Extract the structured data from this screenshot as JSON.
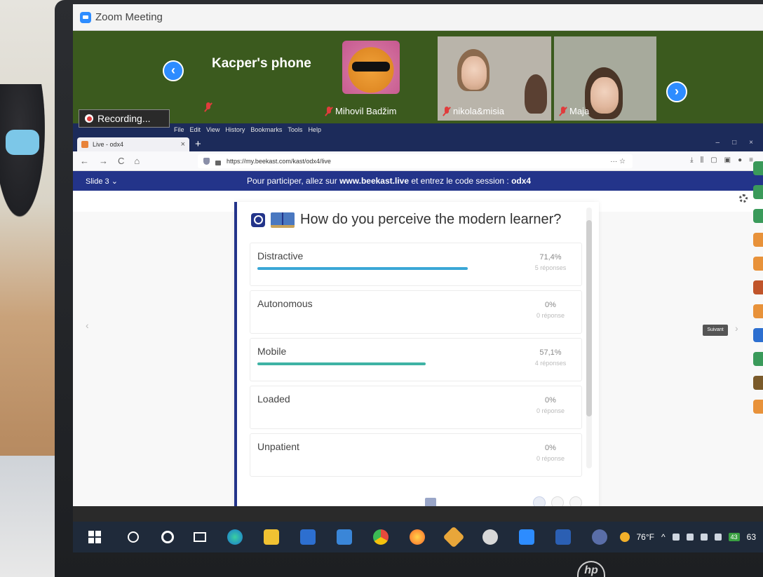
{
  "zoom": {
    "window_title": "Zoom Meeting",
    "participants": [
      {
        "name": "Kacper's phone"
      },
      {
        "name": "Mihovil Badžim"
      },
      {
        "name": "nikola&misia"
      },
      {
        "name": "Maja"
      }
    ],
    "recording_label": "Recording...",
    "prev_arrow": "‹",
    "next_arrow": "›"
  },
  "browser": {
    "menu": [
      "File",
      "Edit",
      "View",
      "History",
      "Bookmarks",
      "Tools",
      "Help"
    ],
    "tab_title": "Live - odx4",
    "tab_close": "×",
    "new_tab": "+",
    "url": "https://my.beekast.com/kast/odx4/live",
    "url_more": "··· ☆",
    "nav": {
      "back": "←",
      "forward": "→",
      "reload": "C",
      "home": "⌂"
    },
    "window_controls": [
      "–",
      "□",
      "×"
    ],
    "toolbar_right": [
      "⤓",
      "⫼",
      "▢",
      "▣",
      "●",
      "≡"
    ]
  },
  "beekast": {
    "slide_selector": "Slide 3 ⌄",
    "join_prefix": "Pour participer, allez sur ",
    "join_site": "www.beekast.live",
    "join_middle": " et entrez le code session : ",
    "join_code": "odx4",
    "next_button": "Suivant",
    "left_arrow": "‹",
    "right_arrow": "›",
    "question": "How do you perceive the modern learner?",
    "options": [
      {
        "label": "Distractive",
        "percent": "71,4%",
        "count": "5 réponses",
        "value": 0.714,
        "color": "#3aa7d6"
      },
      {
        "label": "Autonomous",
        "percent": "0%",
        "count": "0 réponse",
        "value": 0,
        "color": "#3aa7d6"
      },
      {
        "label": "Mobile",
        "percent": "57,1%",
        "count": "4 réponses",
        "value": 0.571,
        "color": "#3fb3a5"
      },
      {
        "label": "Loaded",
        "percent": "0%",
        "count": "0 réponse",
        "value": 0,
        "color": "#3aa7d6"
      },
      {
        "label": "Unpatient",
        "percent": "0%",
        "count": "0 réponse",
        "value": 0,
        "color": "#3aa7d6"
      }
    ]
  },
  "taskbar": {
    "weather": "76°F",
    "tray_caret": "^",
    "badge": "43",
    "clock_partial": "63"
  },
  "colors": {
    "beekast_blue": "#23348a",
    "zoom_blue": "#2d8cff",
    "bar_blue": "#3aa7d6",
    "bar_teal": "#3fb3a5"
  }
}
